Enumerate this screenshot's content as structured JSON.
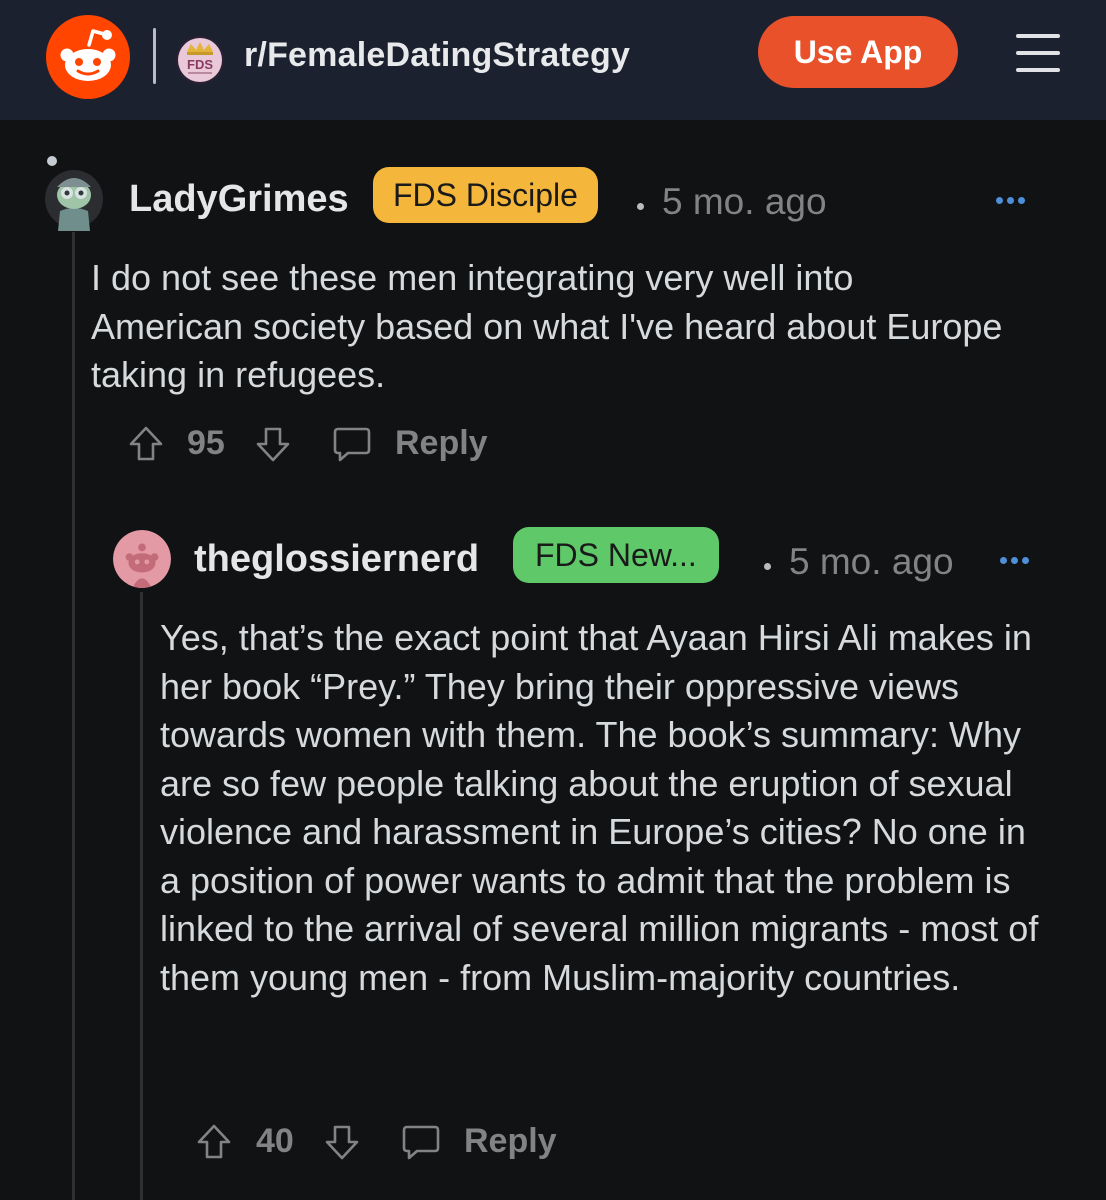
{
  "header": {
    "subreddit": "r/FemaleDatingStrategy",
    "subreddit_icon_text": "FDS",
    "use_app_label": "Use App",
    "brand_color": "#ff4500",
    "header_bg": "#1c2130"
  },
  "comments": [
    {
      "username": "LadyGrimes",
      "flair": "FDS Disciple",
      "flair_color": "#f5b73b",
      "timestamp": "5 mo. ago",
      "body": "I do not see these men integrating very well into American society based on what I've heard about Europe taking in refugees.",
      "votes": "95",
      "reply_label": "Reply"
    },
    {
      "username": "theglossiernerd",
      "flair": "FDS New...",
      "flair_color": "#5fc96a",
      "timestamp": "5 mo. ago",
      "body": "Yes, that’s the exact point that Ayaan Hirsi Ali makes in her book “Prey.” They bring their oppressive views towards women with them. The book’s summary: Why are so few people talking about the eruption of sexual violence and harassment in Europe’s cities? No one in a position of power wants to admit that the problem is linked to the arrival of several million migrants - most of them young men - from Muslim-majority countries.",
      "votes": "40",
      "reply_label": "Reply"
    }
  ]
}
